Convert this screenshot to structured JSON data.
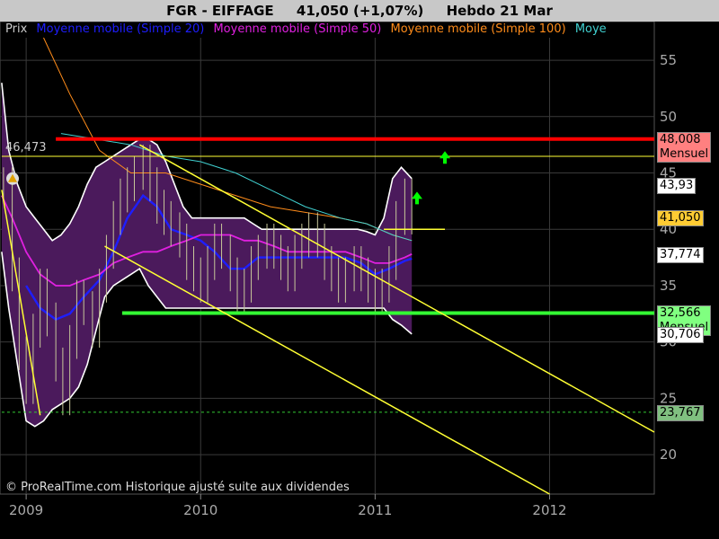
{
  "header": {
    "symbol": "FGR - EIFFAGE",
    "quote": "41,050 (+1,07%)",
    "period": "Hebdo  21 Mar"
  },
  "legend": {
    "items": [
      {
        "label": "Prix",
        "color": "#cccccc"
      },
      {
        "label": "Moyenne mobile (Simple 20)",
        "color": "#1e1eff"
      },
      {
        "label": "Moyenne mobile (Simple 50)",
        "color": "#e020e0"
      },
      {
        "label": "Moyenne mobile (Simple 100)",
        "color": "#ff8c1a"
      },
      {
        "label": "Moye",
        "color": "#40d0d0"
      }
    ]
  },
  "watermark": "© ProRealTime.com Historique ajusté suite aux dividendes",
  "level_label": "46,473",
  "colors": {
    "background": "#000000",
    "band_fill": "#4b1a5c",
    "band_edge": "#ffffff",
    "resistance": "#ff0000",
    "support": "#33ff33",
    "channel": "#ffff33",
    "arrow": "#00ff00"
  },
  "price_tags": [
    {
      "value": 48.008,
      "text": "48,008",
      "sub": "Mensuel",
      "bg": "#ff8080"
    },
    {
      "value": 43.93,
      "text": "43,93",
      "sub": "",
      "bg": "#ffffff"
    },
    {
      "value": 41.05,
      "text": "41,050",
      "sub": "",
      "bg": "#ffcc33"
    },
    {
      "value": 37.774,
      "text": "37,774",
      "sub": "",
      "bg": "#ffffff"
    },
    {
      "value": 32.566,
      "text": "32,566",
      "sub": "Mensuel",
      "bg": "#80ff80"
    },
    {
      "value": 30.706,
      "text": "30,706",
      "sub": "",
      "bg": "#ffffff"
    },
    {
      "value": 23.767,
      "text": "23,767",
      "sub": "",
      "bg": "#80c080"
    }
  ],
  "chart_data": {
    "type": "line",
    "title": "FGR - EIFFAGE",
    "y_axis": {
      "ticks": [
        20,
        25,
        30,
        35,
        40,
        45,
        50,
        55
      ],
      "range": [
        16.5,
        57
      ],
      "position": "right"
    },
    "x_axis": {
      "ticks": [
        "2009",
        "2010",
        "2011",
        "2012"
      ],
      "range": [
        2008.85,
        2012.6
      ]
    },
    "price": {
      "x": [
        2008.87,
        2008.92,
        2008.96,
        2009.0,
        2009.04,
        2009.08,
        2009.12,
        2009.17,
        2009.21,
        2009.25,
        2009.29,
        2009.33,
        2009.38,
        2009.42,
        2009.46,
        2009.5,
        2009.54,
        2009.58,
        2009.62,
        2009.67,
        2009.71,
        2009.75,
        2009.79,
        2009.83,
        2009.88,
        2009.92,
        2009.96,
        2010.0,
        2010.04,
        2010.08,
        2010.12,
        2010.17,
        2010.21,
        2010.25,
        2010.29,
        2010.33,
        2010.38,
        2010.42,
        2010.46,
        2010.5,
        2010.54,
        2010.58,
        2010.62,
        2010.67,
        2010.71,
        2010.75,
        2010.79,
        2010.83,
        2010.88,
        2010.92,
        2010.96,
        2011.0,
        2011.04,
        2011.08,
        2011.12,
        2011.17,
        2011.21
      ],
      "y": [
        44,
        36,
        29,
        26,
        31,
        35,
        32,
        28,
        25,
        30,
        34,
        33,
        31,
        35,
        38,
        41,
        43,
        44,
        45,
        46,
        44,
        42,
        41,
        40,
        39,
        37,
        36,
        35,
        37,
        39,
        38,
        36,
        34,
        35,
        37,
        38,
        39,
        38,
        37,
        36,
        38,
        39,
        40,
        39,
        37,
        36,
        35,
        36,
        37,
        36,
        35,
        34,
        35,
        37,
        41,
        43,
        41.05
      ]
    },
    "series": [
      {
        "name": "Moyenne mobile (Simple 20)",
        "color": "#1e1eff",
        "x": [
          2009.0,
          2009.08,
          2009.17,
          2009.25,
          2009.33,
          2009.42,
          2009.5,
          2009.58,
          2009.67,
          2009.75,
          2009.83,
          2009.92,
          2010.0,
          2010.08,
          2010.17,
          2010.25,
          2010.33,
          2010.42,
          2010.5,
          2010.58,
          2010.67,
          2010.75,
          2010.83,
          2010.92,
          2011.0,
          2011.08,
          2011.17,
          2011.21
        ],
        "y": [
          35,
          33,
          32,
          32.5,
          34,
          35.5,
          38,
          41,
          43,
          42,
          40,
          39.5,
          39,
          38,
          36.5,
          36.5,
          37.5,
          37.5,
          37.5,
          37.5,
          37.5,
          37.5,
          37.5,
          37,
          36,
          36.5,
          37.2,
          37.4
        ]
      },
      {
        "name": "Moyenne mobile (Simple 50)",
        "color": "#e020e0",
        "x": [
          2008.86,
          2008.92,
          2009.0,
          2009.08,
          2009.17,
          2009.25,
          2009.33,
          2009.42,
          2009.5,
          2009.58,
          2009.67,
          2009.75,
          2009.83,
          2009.92,
          2010.0,
          2010.08,
          2010.17,
          2010.25,
          2010.33,
          2010.42,
          2010.5,
          2010.58,
          2010.67,
          2010.75,
          2010.83,
          2010.92,
          2011.0,
          2011.08,
          2011.17,
          2011.21
        ],
        "y": [
          43,
          41,
          38,
          36,
          35,
          35,
          35.5,
          36,
          37,
          37.5,
          38,
          38,
          38.5,
          39,
          39.5,
          39.5,
          39.5,
          39,
          39,
          38.5,
          38,
          38,
          38,
          38,
          38,
          37.5,
          37,
          37,
          37.5,
          37.8
        ]
      },
      {
        "name": "Moyenne mobile (Simple 100)",
        "color": "#ff8c1a",
        "x": [
          2009.1,
          2009.25,
          2009.42,
          2009.6,
          2009.8,
          2010.0,
          2010.2,
          2010.4,
          2010.6,
          2010.8,
          2010.95,
          2011.1,
          2011.21
        ],
        "y": [
          57,
          52,
          47,
          45,
          45,
          44,
          43,
          42,
          41.5,
          41,
          40.5,
          39.5,
          39
        ]
      },
      {
        "name": "Moye",
        "color": "#40d0d0",
        "x": [
          2009.2,
          2009.4,
          2009.6,
          2009.8,
          2010.0,
          2010.2,
          2010.4,
          2010.6,
          2010.8,
          2010.95,
          2011.1,
          2011.21
        ],
        "y": [
          48.5,
          48,
          47.5,
          46.5,
          46,
          45,
          43.5,
          42,
          41,
          40.5,
          39.5,
          39
        ]
      }
    ],
    "bollinger": {
      "x": [
        2008.86,
        2008.9,
        2008.95,
        2009.0,
        2009.05,
        2009.1,
        2009.15,
        2009.2,
        2009.25,
        2009.3,
        2009.35,
        2009.4,
        2009.45,
        2009.5,
        2009.55,
        2009.6,
        2009.65,
        2009.7,
        2009.75,
        2009.8,
        2009.85,
        2009.9,
        2009.95,
        2010.0,
        2010.05,
        2010.1,
        2010.15,
        2010.2,
        2010.25,
        2010.3,
        2010.35,
        2010.4,
        2010.45,
        2010.5,
        2010.55,
        2010.6,
        2010.65,
        2010.7,
        2010.75,
        2010.8,
        2010.85,
        2010.9,
        2010.95,
        2011.0,
        2011.05,
        2011.1,
        2011.15,
        2011.21
      ],
      "upper": [
        53,
        47,
        44,
        42,
        41,
        40,
        39,
        39.5,
        40.5,
        42,
        44,
        45.5,
        46,
        46.5,
        47,
        47.5,
        48,
        48,
        47.5,
        46,
        44,
        42,
        41,
        41,
        41,
        41,
        41,
        41,
        41,
        40.5,
        40,
        40,
        40,
        40,
        40,
        40,
        40,
        40,
        40,
        40,
        40,
        40,
        39.8,
        39.5,
        41,
        44.5,
        45.5,
        44.5
      ],
      "lower": [
        38,
        33,
        28,
        23,
        22.5,
        23,
        24,
        24.5,
        25,
        26,
        28,
        31,
        34,
        35,
        35.5,
        36,
        36.5,
        35,
        34,
        33,
        33,
        33,
        33,
        33,
        33,
        33,
        33,
        33,
        33,
        33,
        33,
        33,
        33,
        33,
        33,
        33,
        33,
        33,
        33,
        33,
        33,
        33,
        33,
        33,
        33,
        32,
        31.5,
        30.7
      ]
    },
    "horizontal_lines": [
      {
        "value": 48.008,
        "label": "Mensuel",
        "color": "#ff0000",
        "x_start": 2009.17
      },
      {
        "value": 46.473,
        "color": "#ffff33",
        "x_start": 2008.86
      },
      {
        "value": 32.566,
        "label": "Mensuel",
        "color": "#33ff33",
        "x_start": 2009.55
      },
      {
        "value": 23.767,
        "color": "#33cc33",
        "dashed": true,
        "x_start": 2008.86
      }
    ],
    "trend_lines": [
      {
        "from": [
          2009.65,
          47.5
        ],
        "to": [
          2012.6,
          22
        ]
      },
      {
        "from": [
          2009.45,
          38.5
        ],
        "to": [
          2012.0,
          16.5
        ]
      },
      {
        "from": [
          2008.86,
          43.5
        ],
        "to": [
          2009.08,
          23.5
        ]
      },
      {
        "from": [
          2011.05,
          40
        ],
        "to": [
          2011.4,
          40
        ]
      }
    ],
    "arrows": [
      {
        "x": 2011.4,
        "y": 46.3
      },
      {
        "x": 2011.24,
        "y": 42.7
      }
    ],
    "grid": true
  }
}
